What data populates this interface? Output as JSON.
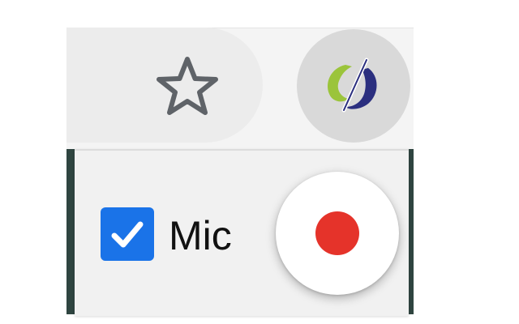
{
  "toolbar": {
    "bookmark_icon": "star-outline-icon",
    "extension_icon": "extension-logo-icon"
  },
  "popup": {
    "mic": {
      "label": "Mic",
      "checked": true,
      "icon": "checkmark-icon"
    },
    "record": {
      "icon": "record-dot-icon"
    }
  },
  "colors": {
    "checkbox_blue": "#1a73e8",
    "record_red": "#e5332a",
    "logo_green": "#9bc43b",
    "logo_navy": "#2b2f7f",
    "page_background": "#2f4540"
  }
}
